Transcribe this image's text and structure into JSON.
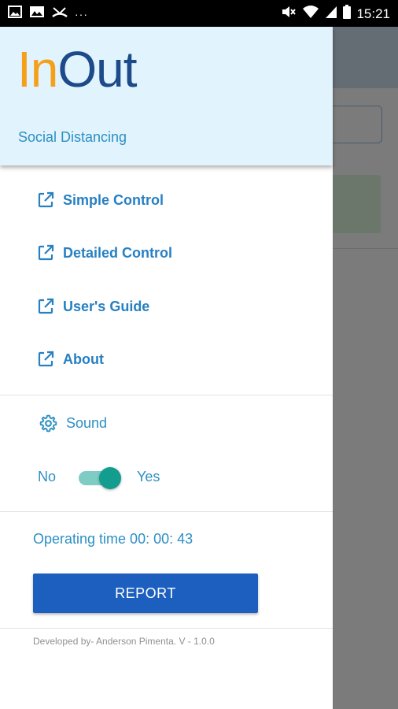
{
  "status_bar": {
    "time": "15:21",
    "dots": "···"
  },
  "drawer": {
    "logo_part1": "In",
    "logo_part2": "Out",
    "subtitle": "Social Distancing",
    "menu": [
      {
        "label": "Simple Control",
        "icon": "open-in-new-icon"
      },
      {
        "label": "Detailed Control",
        "icon": "open-in-new-icon"
      },
      {
        "label": "User's Guide",
        "icon": "open-in-new-icon"
      },
      {
        "label": "About",
        "icon": "open-in-new-icon"
      }
    ],
    "sound": {
      "label": "Sound",
      "icon": "gear-icon"
    },
    "toggle": {
      "no_label": "No",
      "yes_label": "Yes",
      "state": "Yes"
    },
    "operating_time": "Operating time 00: 00: 43",
    "report_button": "REPORT",
    "footer": "Developed by- Anderson Pimenta. V - 1.0.0"
  },
  "colors": {
    "accent_blue": "#2680c2",
    "header_bg": "#e1f3fc",
    "logo_orange": "#f5a01a",
    "logo_navy": "#1c4a8a",
    "button_blue": "#1c5fbf",
    "toggle_teal": "#129d8f"
  }
}
